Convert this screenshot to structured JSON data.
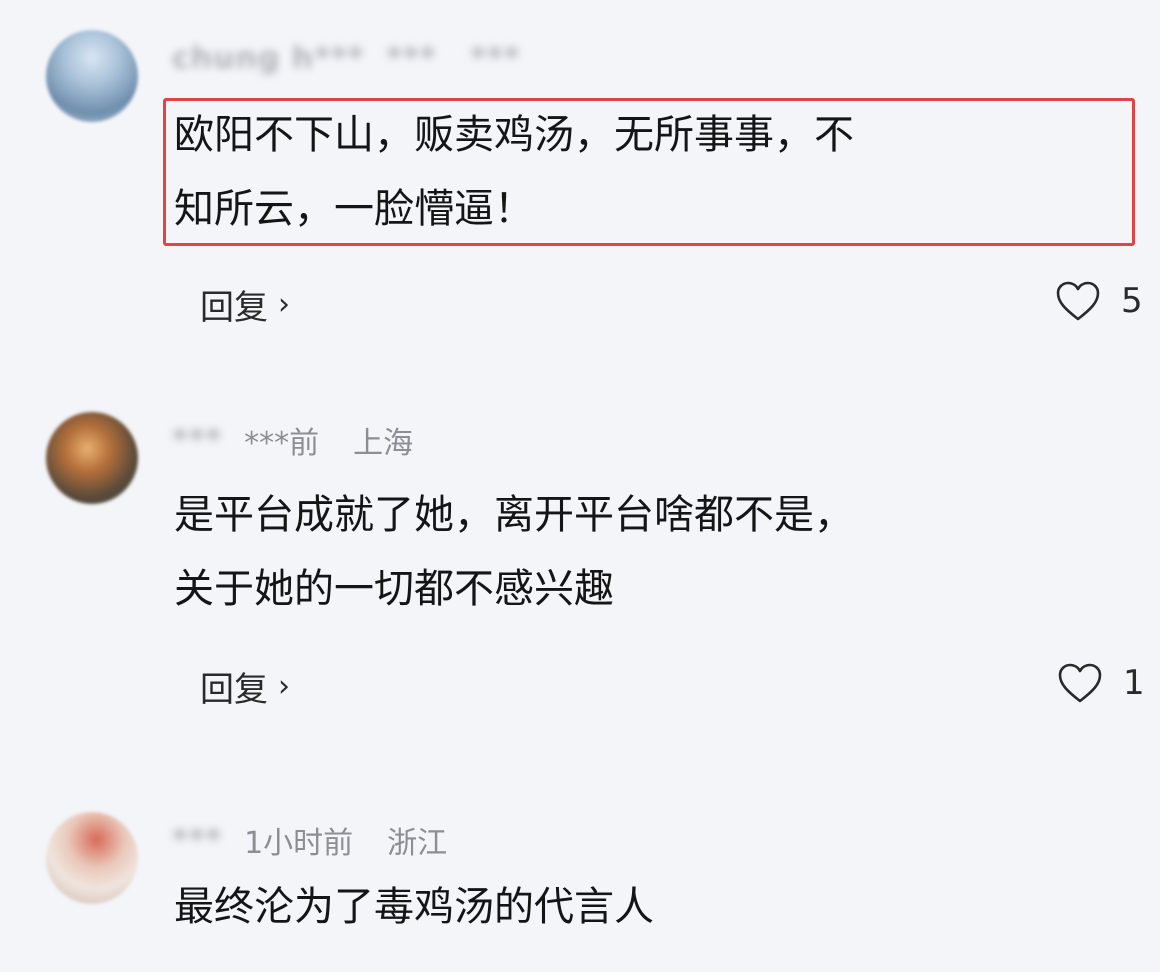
{
  "comments": [
    {
      "username": "chung h***",
      "time": "***",
      "location": "***",
      "text_line1": "欧阳不下山，贩卖鸡汤，无所事事，不",
      "text_line2": "知所云，一脸懵逼！",
      "reply_label": "回复",
      "reply_chevron": "›",
      "likes": "5",
      "highlighted": true
    },
    {
      "username": "***",
      "time": "***前",
      "location": "上海",
      "text_line1": "是平台成就了她，离开平台啥都不是，",
      "text_line2": "关于她的一切都不感兴趣",
      "reply_label": "回复",
      "reply_chevron": "›",
      "likes": "1",
      "highlighted": false
    },
    {
      "username": "***",
      "time": "1小时前",
      "location": "浙江",
      "text_line1": "最终沦为了毒鸡汤的代言人",
      "highlighted": false
    }
  ],
  "icons": {
    "like": "heart-outline-icon",
    "reply": "chevron-right-icon"
  },
  "colors": {
    "highlight_border": "#e04545",
    "meta_text": "#8c8e95",
    "background": "#f4f5f9"
  }
}
